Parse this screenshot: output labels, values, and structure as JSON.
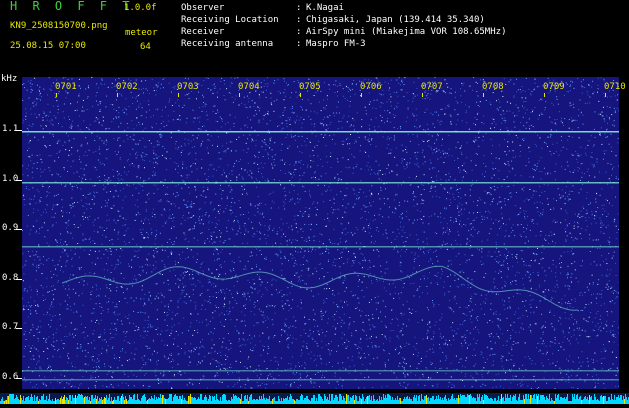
{
  "brand": "H R O F F T",
  "version": "1.0.0f",
  "file_name": "KN9_2508150700.png",
  "meteor_label": "meteor",
  "meteor_count": "64",
  "datetime": "25.08.15 07:00",
  "info": [
    {
      "label": "Observer",
      "value": "K.Nagai"
    },
    {
      "label": "Receiving Location",
      "value": "Chigasaki, Japan (139.414 35.340)"
    },
    {
      "label": "Receiver",
      "value": "AirSpy mini (Miakejima VOR 108.65MHz)"
    },
    {
      "label": "Receiving antenna",
      "value": "Maspro FM-3"
    }
  ],
  "axis_unit": "kHz",
  "x_ticks": [
    "0701",
    "0702",
    "0703",
    "0704",
    "0705",
    "0706",
    "0707",
    "0708",
    "0709",
    "0710"
  ],
  "y_ticks": [
    "1.1",
    "1.0",
    "0.9",
    "0.8",
    "0.7",
    "0.6"
  ],
  "colors": {
    "background": "#15157d",
    "noise": "#6aa0ff",
    "line": "#7ff2d8",
    "bar": "#00d8ff",
    "label": "#e8e800"
  }
}
